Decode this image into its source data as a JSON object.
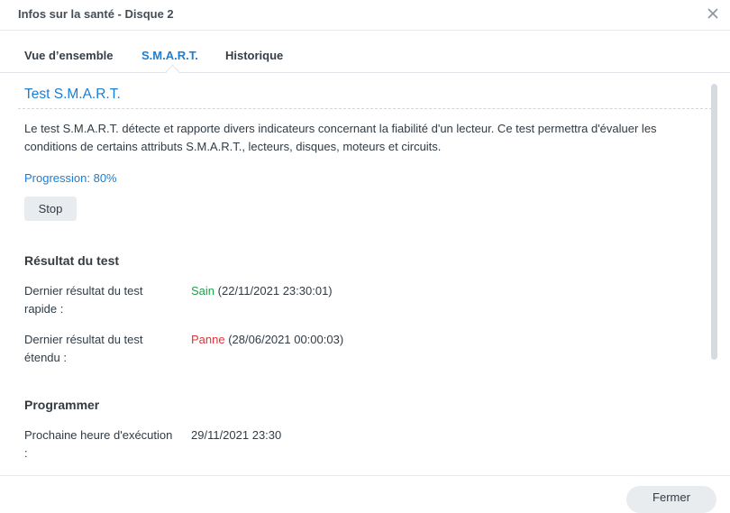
{
  "window": {
    "title": "Infos sur la santé - Disque 2",
    "close_icon": "close-icon"
  },
  "tabs": [
    {
      "label": "Vue d’ensemble",
      "active": false
    },
    {
      "label": "S.M.A.R.T.",
      "active": true
    },
    {
      "label": "Historique",
      "active": false
    }
  ],
  "smart": {
    "title": "Test S.M.A.R.T.",
    "description": "Le test S.M.A.R.T. détecte et rapporte divers indicateurs concernant la fiabilité d'un lecteur. Ce test permettra d'évaluer les conditions de certains attributs S.M.A.R.T., lecteurs, disques, moteurs et circuits.",
    "progress_text": "Progression: 80%",
    "progress_value": 80,
    "stop_label": "Stop"
  },
  "result": {
    "heading": "Résultat du test",
    "quick_label": "Dernier résultat du test rapide :",
    "quick_status": "Sain",
    "quick_date": "(22/11/2021 23:30:01)",
    "extended_label": "Dernier résultat du test étendu :",
    "extended_status": "Panne",
    "extended_date": "(28/06/2021 00:00:03)"
  },
  "schedule": {
    "heading": "Programmer",
    "next_label": "Prochaine heure d'exécution :",
    "next_value": "29/11/2021 23:30"
  },
  "footer": {
    "close_label": "Fermer"
  },
  "colors": {
    "accent": "#1a7ed4",
    "healthy": "#1ea34a",
    "failure": "#e0343c"
  }
}
